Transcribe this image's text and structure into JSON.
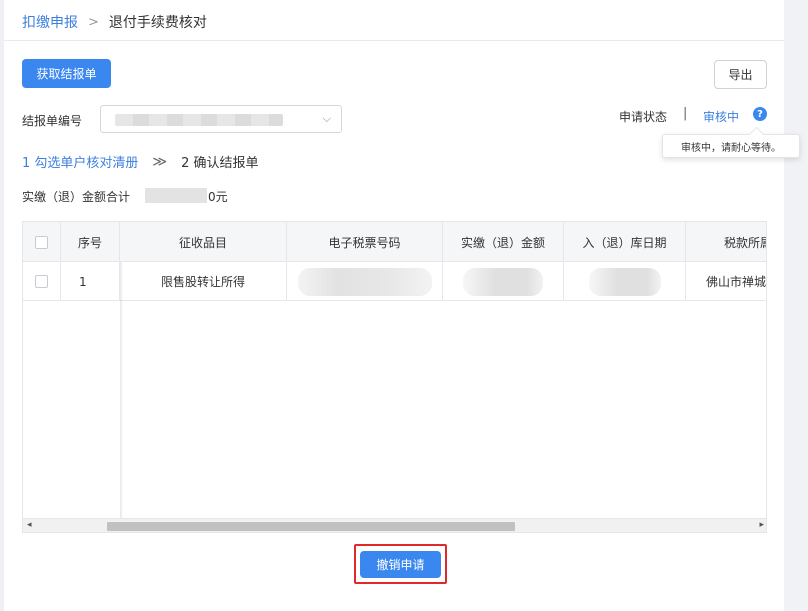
{
  "breadcrumb": {
    "parent": "扣缴申报",
    "separator": ">",
    "current": "退付手续费核对"
  },
  "toolbar": {
    "fetch_label": "获取结报单",
    "export_label": "导出"
  },
  "form": {
    "report_no_label": "结报单编号",
    "report_no_value": "",
    "chevron": "⌵"
  },
  "status": {
    "label": "申请状态",
    "separator": "|",
    "value": "审核中",
    "help_icon": "?",
    "tooltip": "审核中，请耐心等待。"
  },
  "steps": {
    "step1": "1 勾选单户核对清册",
    "arrow": "≫",
    "step2": "2 确认结报单"
  },
  "total": {
    "label": "实缴（退）金额合计",
    "value_suffix": "0元"
  },
  "table": {
    "columns": [
      "序号",
      "征收品目",
      "电子税票号码",
      "实缴（退）金额",
      "入（退）库日期",
      "税款所属"
    ],
    "rows": [
      {
        "index": "1",
        "item": "限售股转让所得",
        "ticket_no": "",
        "amount": "",
        "date": "",
        "region": "佛山市禅城区"
      }
    ]
  },
  "scrollbar": {
    "left_arrow": "◂",
    "right_arrow": "▸"
  },
  "actions": {
    "cancel_label": "撤销申请"
  },
  "colors": {
    "primary": "#3b87f0",
    "link": "#3d7fe0",
    "highlight_border": "#e02a2a"
  }
}
